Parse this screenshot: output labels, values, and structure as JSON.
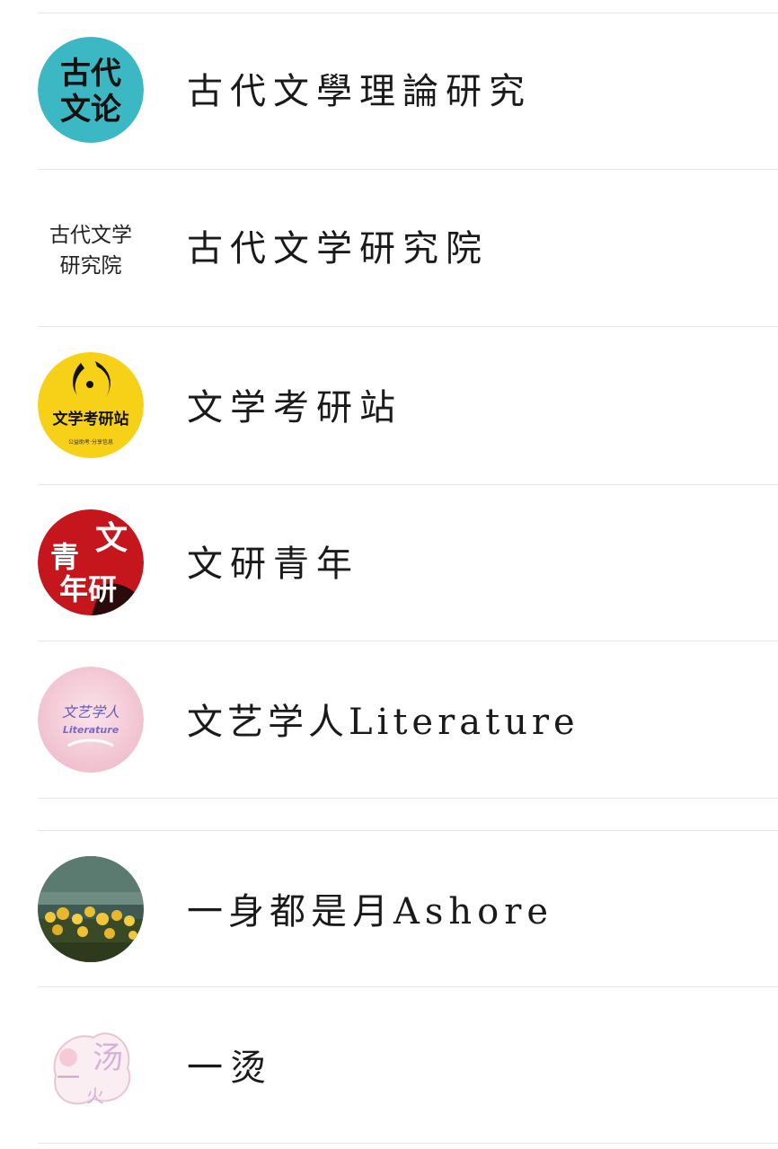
{
  "accounts": [
    {
      "name": "古代文學理論研究",
      "avatar_text": [
        "古代",
        "文论"
      ],
      "avatar_bg": "#3bb8c4"
    },
    {
      "name": "古代文学研究院",
      "avatar_text": [
        "古代文学",
        "研究院"
      ],
      "avatar_bg": "#ffffff"
    },
    {
      "name": "文学考研站",
      "avatar_text": [
        "文学考研站",
        "公益助考·分享信息"
      ],
      "avatar_bg": "#f7d117"
    },
    {
      "name": "文研青年",
      "avatar_text": [
        "文",
        "青",
        "年研"
      ],
      "avatar_bg": "#c4161c"
    },
    {
      "name": "文艺学人Literature",
      "avatar_text": [
        "文艺学人",
        "Literature"
      ],
      "avatar_bg": "#f3c6d3"
    },
    {
      "name": "一身都是月Ashore",
      "avatar_bg": "#4a5a3a"
    },
    {
      "name": "一烫",
      "avatar_text": [
        "一",
        "汤",
        "火"
      ],
      "avatar_bg": "#ffffff"
    }
  ]
}
